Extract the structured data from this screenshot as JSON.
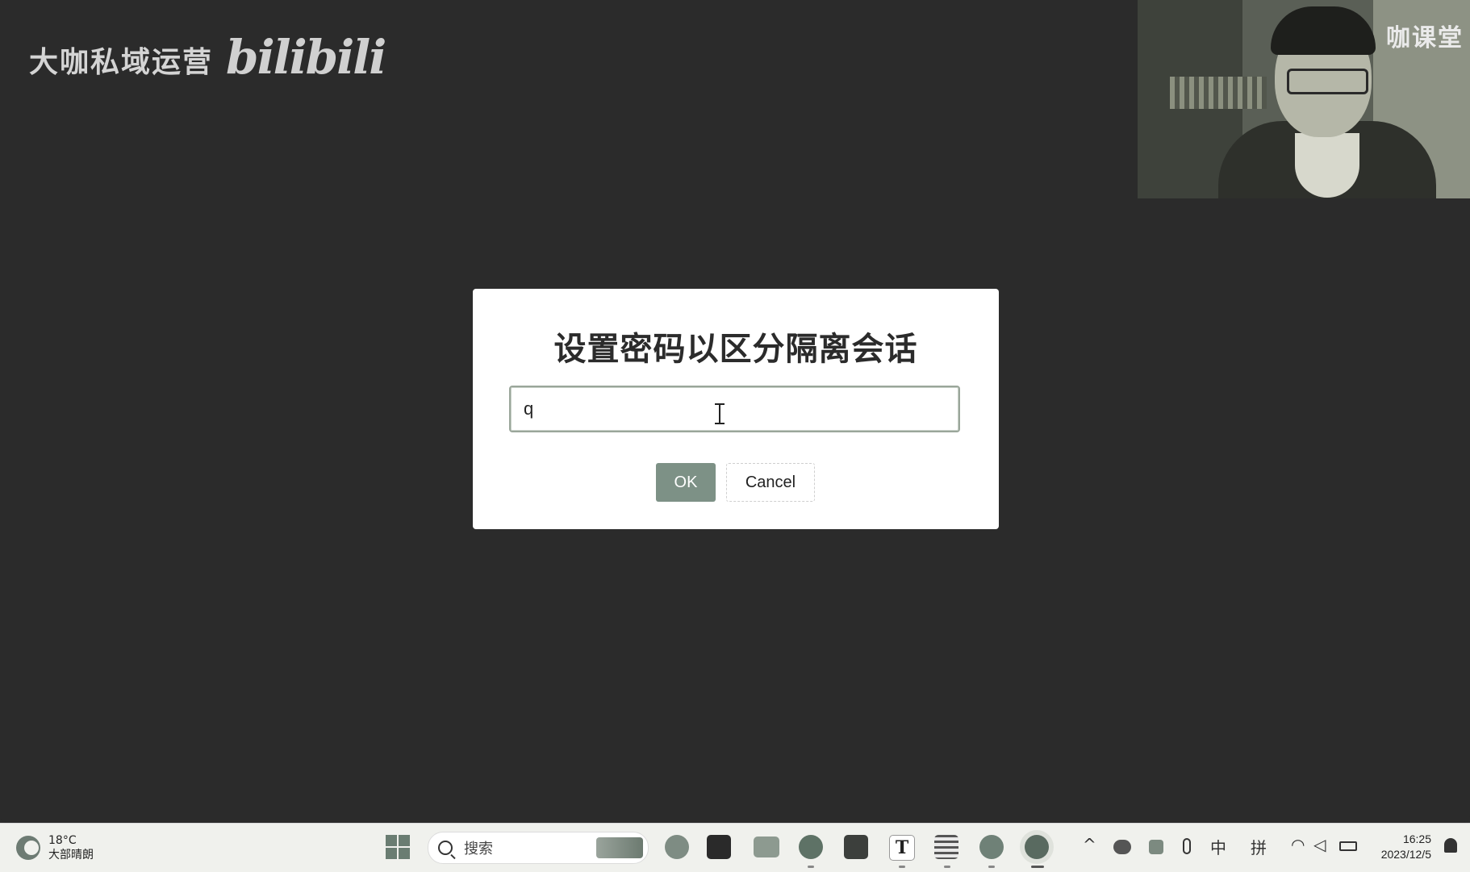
{
  "watermark": {
    "channel": "大咖私域运营",
    "logo": "bilibili"
  },
  "webcam": {
    "brand_text": "咖课堂"
  },
  "dialog": {
    "title": "设置密码以区分隔离会话",
    "input_value": "q",
    "ok_label": "OK",
    "cancel_label": "Cancel"
  },
  "taskbar": {
    "weather": {
      "temp": "18°C",
      "desc": "大部晴朗"
    },
    "search_placeholder": "搜索",
    "apps": [
      "start-icon",
      "pre-app-icon",
      "dark-app-icon",
      "folder-icon",
      "edge-icon",
      "calculator-icon",
      "typora-icon",
      "notepad-icon",
      "chrome-icon",
      "dev-browser-icon"
    ],
    "tray": {
      "ime_mode": "中",
      "ime_type": "拼"
    },
    "clock": {
      "time": "16:25",
      "date": "2023/12/5"
    }
  },
  "colors": {
    "ok_button": "#7d9186",
    "desktop_bg": "#2b2b2b",
    "taskbar_bg": "#f0f1ed"
  }
}
